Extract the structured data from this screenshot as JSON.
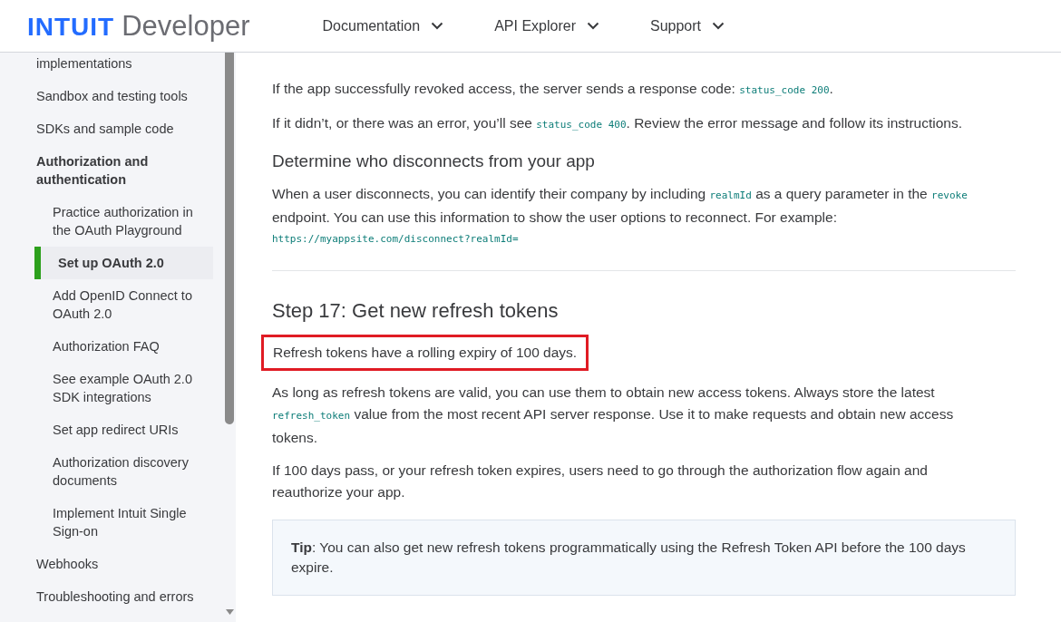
{
  "header": {
    "logo_brand": "INTUIT",
    "logo_product": "Developer",
    "nav": [
      {
        "label": "Documentation"
      },
      {
        "label": "API Explorer"
      },
      {
        "label": "Support"
      }
    ]
  },
  "sidebar": {
    "items": [
      {
        "label": "implementations",
        "selected": false
      },
      {
        "label": "Sandbox and testing tools",
        "selected": false
      },
      {
        "label": "SDKs and sample code",
        "selected": false
      },
      {
        "label": "Authorization and authentication",
        "selected": false,
        "children": [
          {
            "label": "Practice authorization in the OAuth Playground",
            "selected": false
          },
          {
            "label": "Set up OAuth 2.0",
            "selected": true
          },
          {
            "label": "Add OpenID Connect to OAuth 2.0",
            "selected": false
          },
          {
            "label": "Authorization FAQ",
            "selected": false
          },
          {
            "label": "See example OAuth 2.0 SDK integrations",
            "selected": false
          },
          {
            "label": "Set app redirect URIs",
            "selected": false
          },
          {
            "label": "Authorization discovery documents",
            "selected": false
          },
          {
            "label": "Implement Intuit Single Sign-on",
            "selected": false
          }
        ]
      },
      {
        "label": "Webhooks",
        "selected": false
      },
      {
        "label": "Troubleshooting and errors",
        "selected": false
      }
    ]
  },
  "content": [
    {
      "kind": "paragraph",
      "segments": [
        {
          "kind": "text",
          "text": "If the app successfully revoked access, the server sends a response code: "
        },
        {
          "kind": "code",
          "text": "status_code 200"
        },
        {
          "kind": "text",
          "text": "."
        }
      ]
    },
    {
      "kind": "paragraph",
      "segments": [
        {
          "kind": "text",
          "text": "If it didn’t, or there was an error, you’ll see "
        },
        {
          "kind": "code",
          "text": "status_code 400"
        },
        {
          "kind": "text",
          "text": ". Review the error message and follow its instructions."
        }
      ]
    },
    {
      "kind": "subheading",
      "text": "Determine who disconnects from your app"
    },
    {
      "kind": "paragraph",
      "segments": [
        {
          "kind": "text",
          "text": "When a user disconnects, you can identify their company by including "
        },
        {
          "kind": "code",
          "text": "realmId"
        },
        {
          "kind": "text",
          "text": " as a query parameter in the "
        },
        {
          "kind": "code",
          "text": "revoke"
        },
        {
          "kind": "text",
          "text": " endpoint. You can use this information to show the user options to reconnect. For example:"
        }
      ]
    },
    {
      "kind": "code_line",
      "text": "https://myappsite.com/disconnect?realmId="
    },
    {
      "kind": "divider"
    },
    {
      "kind": "heading",
      "text": "Step 17: Get new refresh tokens"
    },
    {
      "kind": "highlighted",
      "text": "Refresh tokens have a rolling expiry of 100 days."
    },
    {
      "kind": "paragraph",
      "segments": [
        {
          "kind": "text",
          "text": "As long as refresh tokens are valid, you can use them to obtain new access tokens. Always store the latest "
        },
        {
          "kind": "code",
          "text": "refresh_token"
        },
        {
          "kind": "text",
          "text": " value from the most recent API server response. Use it to make requests and obtain new access tokens."
        }
      ]
    },
    {
      "kind": "paragraph",
      "segments": [
        {
          "kind": "text",
          "text": "If 100 days pass, or your refresh token expires, users need to go through the authorization flow again and reauthorize your app."
        }
      ]
    },
    {
      "kind": "tip",
      "text": "**Tip**: You can also get new refresh tokens programmatically using the Refresh Token API before the 100 days expire."
    }
  ]
}
